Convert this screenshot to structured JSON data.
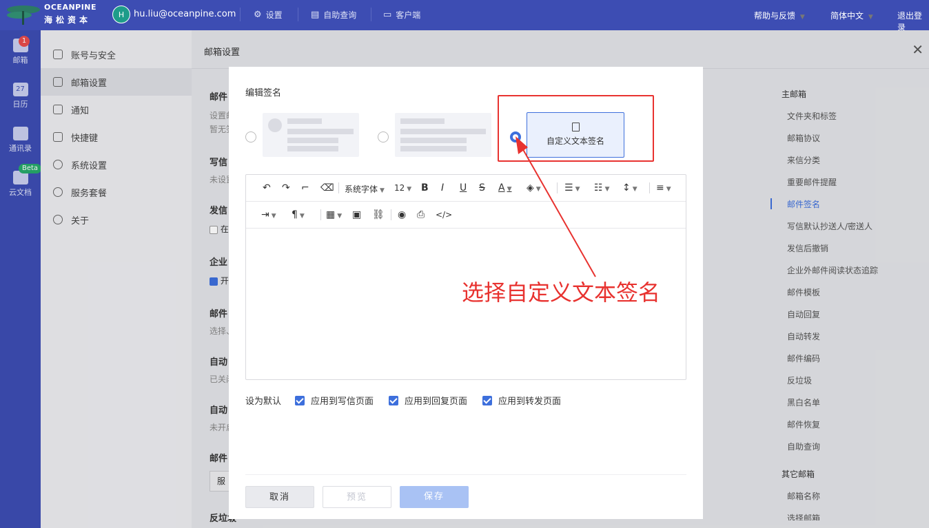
{
  "brand": {
    "en": "OCEANPINE",
    "cn": "海松资本"
  },
  "user": {
    "avatar": "H",
    "email": "hu.liu@oceanpine.com"
  },
  "topnav": [
    {
      "label": "设置",
      "icon": "gear-icon"
    },
    {
      "label": "自助查询",
      "icon": "query-icon"
    },
    {
      "label": "客户端",
      "icon": "monitor-icon"
    }
  ],
  "topright": {
    "help": "帮助与反馈",
    "lang": "简体中文",
    "logout": "退出登录"
  },
  "leftnav": [
    {
      "label": "邮箱",
      "badge": "1"
    },
    {
      "label": "日历",
      "day": "27"
    },
    {
      "label": "通讯录"
    },
    {
      "label": "云文档",
      "badge": "Beta"
    }
  ],
  "settings_menu": [
    "账号与安全",
    "邮箱设置",
    "通知",
    "快捷键",
    "系统设置",
    "服务套餐",
    "关于"
  ],
  "main": {
    "title": "邮箱设置",
    "peek": [
      {
        "title": "邮件",
        "sub": "设置邮",
        "sub2": "暂无签"
      },
      {
        "title": "写信",
        "sub": "未设置"
      },
      {
        "title": "发信",
        "opt": "在"
      },
      {
        "title": "企业",
        "opt": "开"
      },
      {
        "title": "邮件",
        "sub": "选择、"
      },
      {
        "title": "自动",
        "sub": "已关闭"
      },
      {
        "title": "自动",
        "sub": "未开启"
      },
      {
        "title": "邮件",
        "box": "服"
      },
      {
        "title": "反垃圾"
      }
    ]
  },
  "anchor": {
    "group1": "主邮箱",
    "items1": [
      "文件夹和标签",
      "邮箱协议",
      "来信分类",
      "重要邮件提醒",
      "邮件签名",
      "写信默认抄送人/密送人",
      "发信后撤销",
      "企业外邮件阅读状态追踪",
      "邮件模板",
      "自动回复",
      "自动转发",
      "邮件编码",
      "反垃圾",
      "黑白名单",
      "邮件恢复",
      "自助查询"
    ],
    "group2": "其它邮箱",
    "items2": [
      "邮箱名称",
      "选择邮箱"
    ]
  },
  "modal": {
    "title": "编辑签名",
    "custom_label": "自定义文本签名",
    "toolbar": {
      "font": "系统字体",
      "size": "12"
    },
    "default_label": "设为默认",
    "defaults": [
      "应用到写信页面",
      "应用到回复页面",
      "应用到转发页面"
    ],
    "buttons": {
      "cancel": "取消",
      "preview": "预览",
      "save": "保存"
    }
  },
  "annotation": "选择自定义文本签名"
}
